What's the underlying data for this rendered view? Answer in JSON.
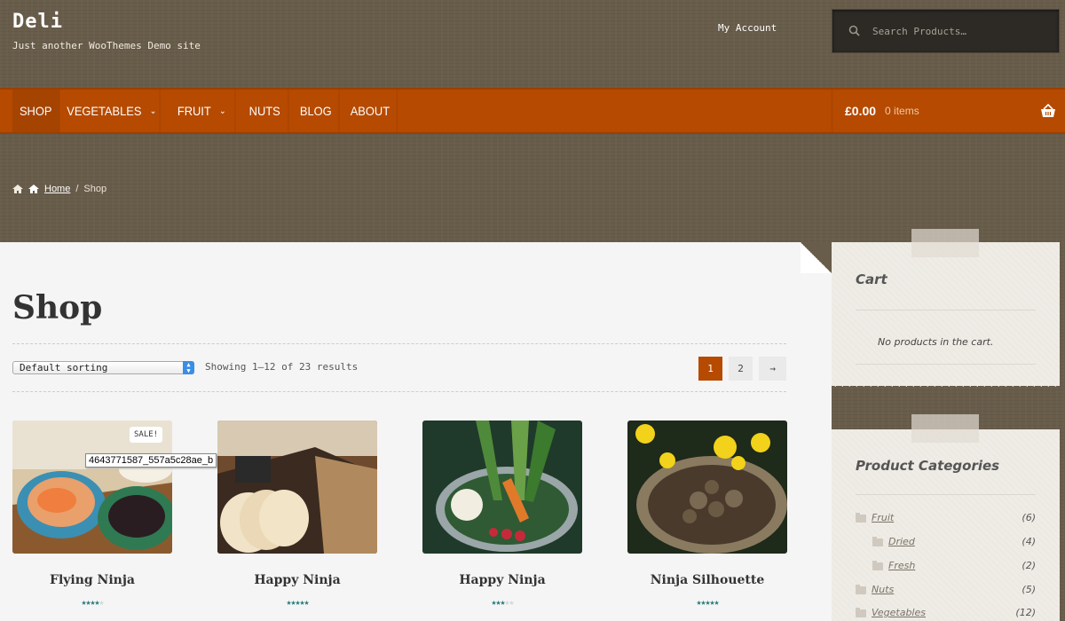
{
  "header": {
    "site_title": "Deli",
    "site_description": "Just another WooThemes Demo site",
    "my_account": "My Account",
    "search_placeholder": "Search Products…"
  },
  "nav": {
    "items": [
      {
        "label": "SHOP",
        "active": true
      },
      {
        "label": "VEGETABLES",
        "dropdown": true
      },
      {
        "label": "FRUIT",
        "dropdown": true
      },
      {
        "label": "NUTS"
      },
      {
        "label": "BLOG"
      },
      {
        "label": "ABOUT"
      }
    ],
    "cart_amount": "£0.00",
    "cart_items": "0 items",
    "chevron": "⌄"
  },
  "breadcrumb": {
    "home": "Home",
    "separator": "/",
    "current": "Shop"
  },
  "main": {
    "title": "Shop",
    "sort_selected": "Default sorting",
    "result_count": "Showing 1–12 of 23 results",
    "pagination": {
      "current": "1",
      "page2": "2",
      "next": "→"
    },
    "tooltip": "4643771587_557a5c28ae_b",
    "sale_badge": "SALE!",
    "products": [
      {
        "name": "Flying Ninja",
        "rating": 4,
        "sale": true
      },
      {
        "name": "Happy Ninja",
        "rating": 5
      },
      {
        "name": "Happy Ninja",
        "rating": 3
      },
      {
        "name": "Ninja Silhouette",
        "rating": 5
      }
    ]
  },
  "sidebar": {
    "cart_title": "Cart",
    "cart_empty": "No products in the cart.",
    "categories_title": "Product Categories",
    "categories": [
      {
        "name": "Fruit",
        "count": "(6)",
        "level": 0
      },
      {
        "name": "Dried",
        "count": "(4)",
        "level": 1
      },
      {
        "name": "Fresh",
        "count": "(2)",
        "level": 1
      },
      {
        "name": "Nuts",
        "count": "(5)",
        "level": 0
      },
      {
        "name": "Vegetables",
        "count": "(12)",
        "level": 0
      }
    ]
  },
  "colors": {
    "accent": "#b64a00",
    "star": "#2a7d7d"
  }
}
